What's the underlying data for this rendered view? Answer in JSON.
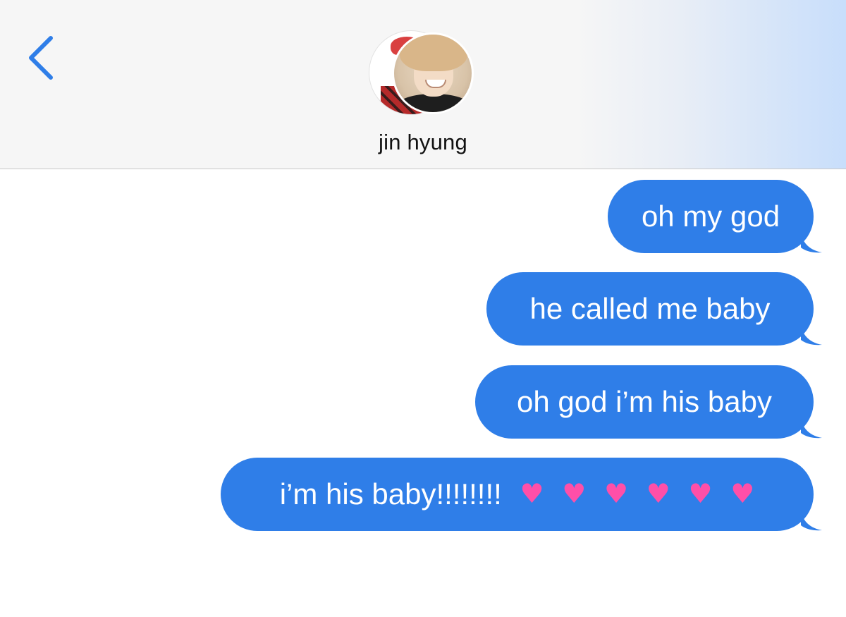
{
  "header": {
    "contact_name": "jin hyung"
  },
  "colors": {
    "bubble": "#2f7ee8",
    "back_chevron": "#2f7ee8",
    "header_bg": "#f6f6f6",
    "emoji_pink": "#ff4fa8"
  },
  "messages": [
    {
      "text": "oh my god"
    },
    {
      "text": "he called me baby"
    },
    {
      "text": "oh god i’m his baby"
    },
    {
      "text": "i’m his baby!!!!!!!!",
      "emojis": [
        "two-hearts",
        "sparkling-heart",
        "two-hearts",
        "growing-heart",
        "revolving-hearts",
        "sparkling-heart"
      ],
      "emoji_glyphs": [
        "♥",
        "♥",
        "♥",
        "♥",
        "♥",
        "♥"
      ]
    }
  ]
}
